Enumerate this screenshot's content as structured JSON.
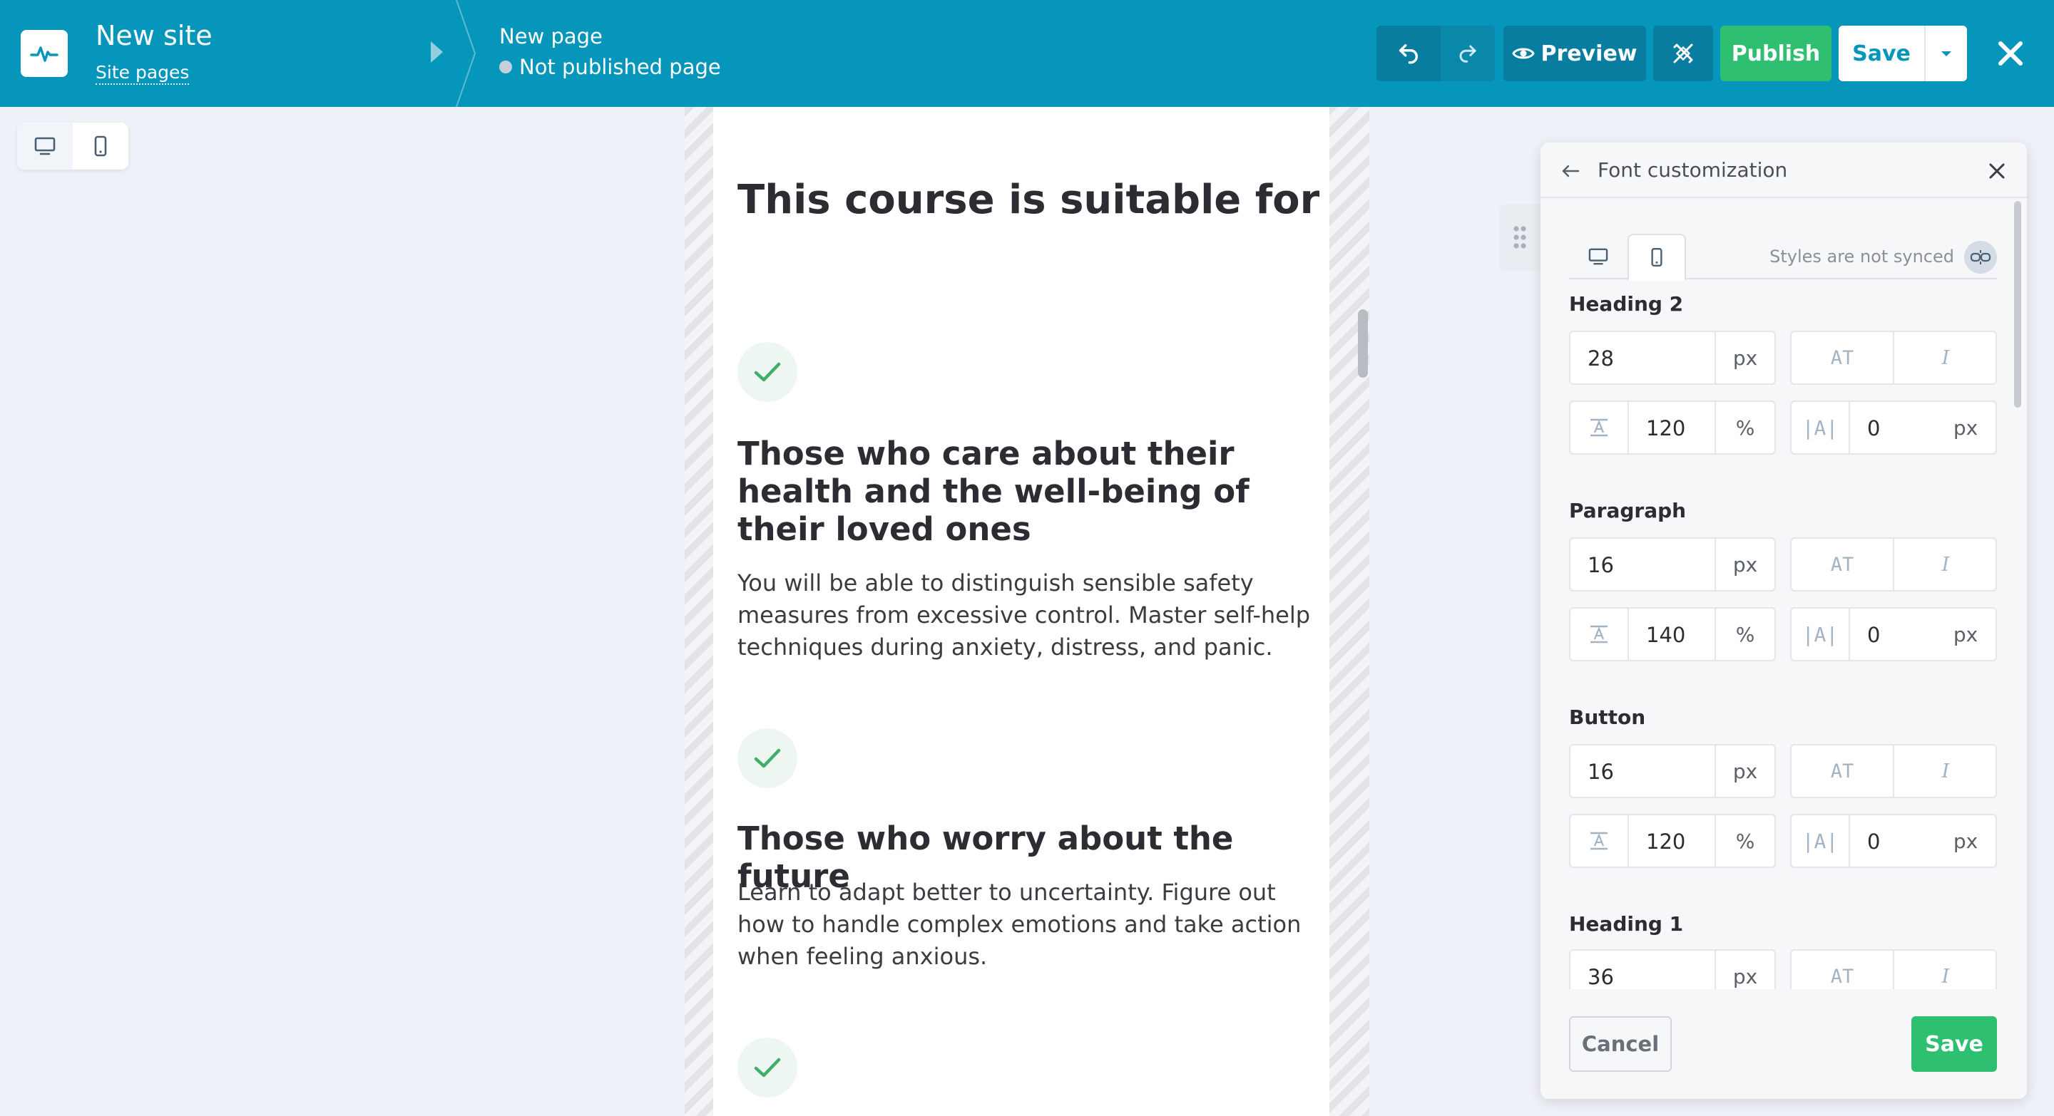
{
  "header": {
    "site_title": "New site",
    "site_pages_link": "Site pages",
    "page_name": "New page",
    "page_status": "Not published page",
    "preview_label": "Preview",
    "publish_label": "Publish",
    "save_label": "Save"
  },
  "canvas": {
    "title": "This course is suitable for",
    "items": [
      {
        "heading": "Those who care about their health and the well-being of their loved ones",
        "text": "You will be able to distinguish sensible safety measures from excessive control. Master self-help techniques during anxiety, distress, and panic."
      },
      {
        "heading": "Those who worry about the future",
        "text": "Learn to adapt better to uncertainty. Figure out how to handle complex emotions and take action when feeling anxious."
      }
    ]
  },
  "panel": {
    "title": "Font customization",
    "sync_status": "Styles are not synced",
    "style_bold_glyph": "AT",
    "style_italic_glyph": "I",
    "letter_spacing_glyph": "|A|",
    "sections": [
      {
        "label": "Heading 2",
        "size": "28",
        "size_unit": "px",
        "line_height": "120",
        "line_height_unit": "%",
        "letter_spacing": "0",
        "letter_spacing_unit": "px"
      },
      {
        "label": "Paragraph",
        "size": "16",
        "size_unit": "px",
        "line_height": "140",
        "line_height_unit": "%",
        "letter_spacing": "0",
        "letter_spacing_unit": "px"
      },
      {
        "label": "Button",
        "size": "16",
        "size_unit": "px",
        "line_height": "120",
        "line_height_unit": "%",
        "letter_spacing": "0",
        "letter_spacing_unit": "px"
      },
      {
        "label": "Heading 1",
        "size": "36",
        "size_unit": "px"
      }
    ],
    "cancel_label": "Cancel",
    "save_label": "Save"
  },
  "colors": {
    "topbar": "#0796bb",
    "publish": "#2fbf71",
    "check": "#3fae6a"
  }
}
